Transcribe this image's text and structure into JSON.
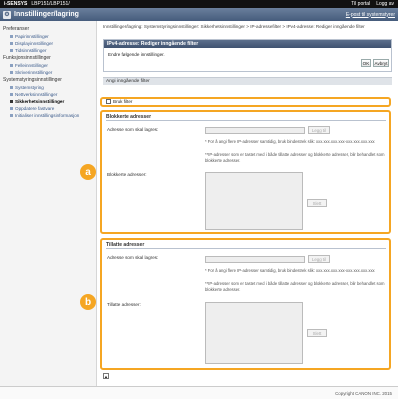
{
  "topbar": {
    "brand": "i-SENSYS",
    "model": "LBP151/LBP151/",
    "portal": "Til portal",
    "logout": "Logg av"
  },
  "titlebar": {
    "title": "Innstillinger/lagring",
    "mail": "E-post til systemstyrer"
  },
  "sidebar": {
    "groups": [
      {
        "label": "Preferanser",
        "items": [
          "Papirinnstillinger",
          "Displayinnstillinger",
          "Tidsinnstillinger"
        ]
      },
      {
        "label": "Funksjonsinnstillinger",
        "items": [
          "Felleinnstillinger",
          "Skriverinnstillinger"
        ]
      },
      {
        "label": "Systemstyringsinnstillinger",
        "items": [
          "Systemstyring",
          "Nettverksinnstillinger",
          "Sikkerhetsinnstillinger",
          "Oppdatere fastvare",
          "Initialiser innstillingsinformasjon"
        ]
      }
    ],
    "active": "Sikkerhetsinnstillinger"
  },
  "main": {
    "breadcrumb": "Innstillinger/lagring: Systemstyringsinnstillinger: Sikkerhetsinnstillinger > IP-adressefilter > IPv4-adresse: Rediger inngående filter",
    "panel_title": "IPv4-adresse: Rediger inngående filter",
    "panel_text": "Endre følgende innstillinger.",
    "ok": "OK",
    "cancel": "Avbryt",
    "section_head": "Angi inngående filter",
    "use_filter": "Bruk filter",
    "blocked": {
      "title": "Blokkerte adresser",
      "address_label": "Adresse som skal lagres:",
      "add": "Legg til",
      "note1": "* For å angi flere IP-adresser samtidig, bruk bindestrek slik: xxx.xxx.xxx.xxx-xxx.xxx.xxx.xxx",
      "note2": "**IP-adresser som er tastet med i både tillatte adresser og blokkerte adresser, blir behandlet som blokkerte adresser.",
      "list_label": "Blokkerte adresser:",
      "delete": "Slett"
    },
    "allowed": {
      "title": "Tillatte adresser",
      "address_label": "Adresse som skal lagres:",
      "add": "Legg til",
      "note1": "* For å angi flere IP-adresser samtidig, bruk bindestrek slik: xxx.xxx.xxx.xxx-xxx.xxx.xxx.xxx",
      "note2": "**IP-adresser som er tastet med i både tillatte adresser og blokkerte adresser, blir behandlet som blokkerte adresser.",
      "list_label": "Tillatte adresser:",
      "delete": "Slett"
    },
    "callout_a": "a",
    "callout_b": "b"
  },
  "footer": {
    "copyright": "Copyright CANON INC. 2015"
  },
  "colors": {
    "accent": "#f5a623",
    "header": "#465c7c"
  }
}
